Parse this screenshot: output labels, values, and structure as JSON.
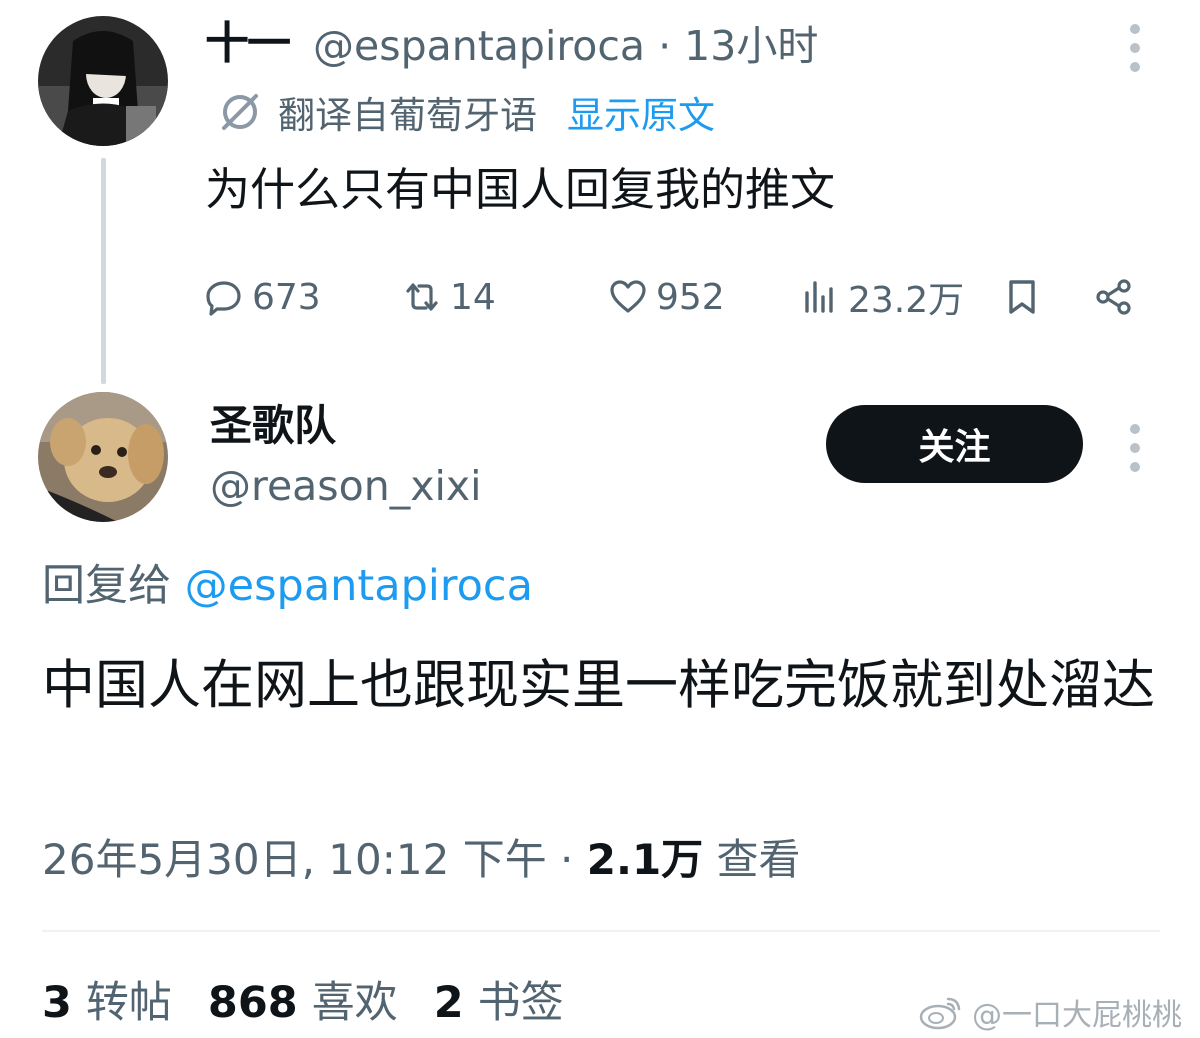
{
  "original_tweet": {
    "display_name": "十一",
    "handle": "@espantapiroca",
    "time": "· 13小时",
    "translation_note": "翻译自葡萄牙语",
    "show_original": "显示原文",
    "text": "为什么只有中国人回复我的推文",
    "actions": {
      "replies": "673",
      "retweets": "14",
      "likes": "952",
      "views": "23.2万"
    }
  },
  "reply_tweet": {
    "display_name": "圣歌队",
    "handle": "@reason_xixi",
    "follow_label": "关注",
    "reply_to_prefix": "回复给",
    "reply_to_mention": "@espantapiroca",
    "text": "中国人在网上也跟现实里一样吃完饭就到处溜达",
    "timestamp": "26年5月30日, 10:12 下午 ·",
    "views_count": "2.1万",
    "views_label": "查看",
    "stats": [
      {
        "count": "3",
        "label": "转帖"
      },
      {
        "count": "868",
        "label": "喜欢"
      },
      {
        "count": "2",
        "label": "书签"
      }
    ]
  },
  "watermark": "@一口大屁桃桃",
  "colors": {
    "text_primary": "#0f1419",
    "text_secondary": "#536471",
    "link": "#1d9bf0",
    "follow_button": "#0f1419",
    "thread_line": "#cfd9de"
  }
}
